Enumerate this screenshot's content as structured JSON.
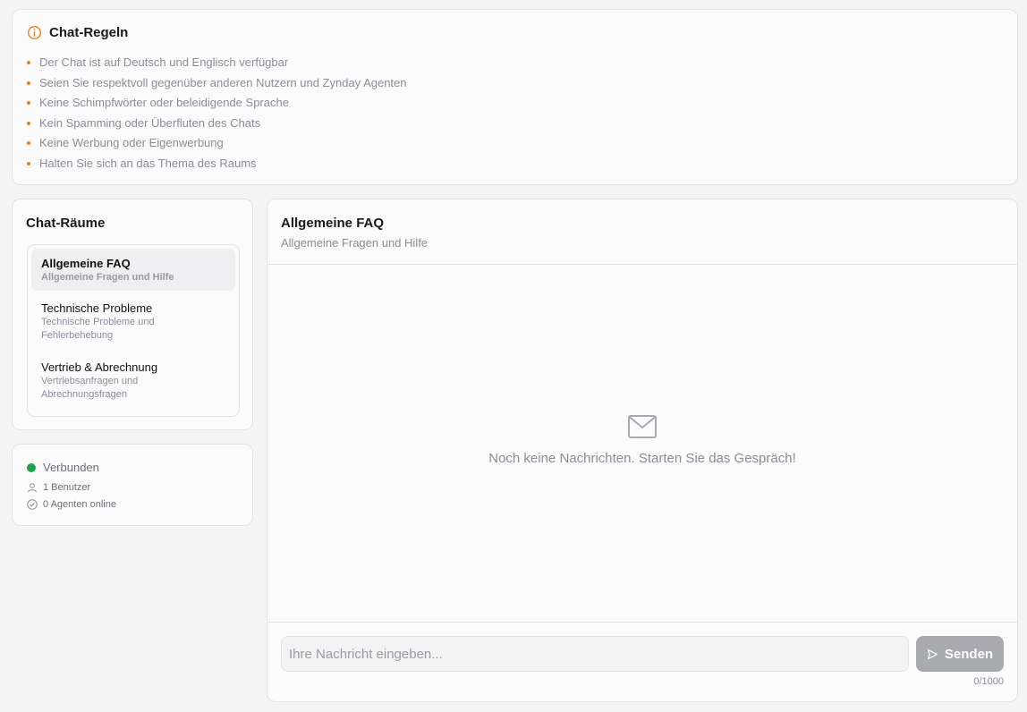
{
  "rules": {
    "title": "Chat-Regeln",
    "items": [
      "Der Chat ist auf Deutsch und Englisch verfügbar",
      "Seien Sie respektvoll gegenüber anderen Nutzern und Zynday Agenten",
      "Keine Schimpfwörter oder beleidigende Sprache",
      "Kein Spamming oder Überfluten des Chats",
      "Keine Werbung oder Eigenwerbung",
      "Halten Sie sich an das Thema des Raums"
    ],
    "accent_color": "#e57f1a"
  },
  "rooms": {
    "title": "Chat-Räume",
    "items": [
      {
        "name": "Allgemeine FAQ",
        "description": "Allgemeine Fragen und Hilfe",
        "active": true
      },
      {
        "name": "Technische Probleme",
        "description": "Technische Probleme und Fehlerbehebung",
        "active": false
      },
      {
        "name": "Vertrieb & Abrechnung",
        "description": "Vertriebsanfragen und Abrechnungsfragen",
        "active": false
      }
    ]
  },
  "status": {
    "connection": "Verbunden",
    "connection_color": "#1aa34a",
    "users": "1 Benutzer",
    "agents": "0 Agenten online"
  },
  "chat": {
    "room_name": "Allgemeine FAQ",
    "room_description": "Allgemeine Fragen und Hilfe",
    "empty_message": "Noch keine Nachrichten. Starten Sie das Gespräch!",
    "input_placeholder": "Ihre Nachricht eingeben...",
    "input_value": "",
    "send_label": "Senden",
    "char_counter": "0/1000"
  }
}
